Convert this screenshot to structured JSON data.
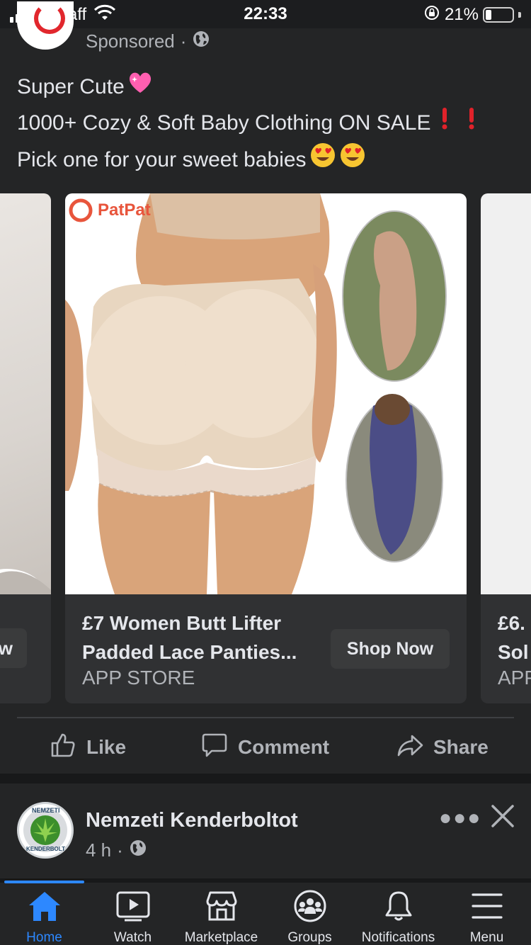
{
  "status_bar": {
    "carrier": "giffgaff",
    "time": "22:33",
    "battery_percent": "21%",
    "battery_level": 0.21,
    "signal_bars": 2
  },
  "post": {
    "sponsored_label": "Sponsored",
    "separator": "·",
    "text_lines": [
      "Super Cute",
      "1000+ Cozy & Soft Baby Clothing ON SALE",
      "Pick one for your sweet babies"
    ],
    "carousel": {
      "left_card": {
        "button_label_fragment": "ow"
      },
      "main_card": {
        "brand_logo": "PatPat",
        "title_line1": "£7 Women Butt Lifter",
        "title_line2": "Padded Lace Panties...",
        "source": "APP STORE",
        "cta_label": "Shop Now"
      },
      "right_card": {
        "title_line1": "£6.",
        "title_line2": "Sol",
        "source": "APP"
      }
    },
    "actions": {
      "like": "Like",
      "comment": "Comment",
      "share": "Share"
    }
  },
  "next_post": {
    "page_name": "Nemzeti Kenderboltot",
    "time": "4 h",
    "separator": "·",
    "avatar_text_top": "NEMZETI",
    "avatar_text_bottom": "KENDERBOLT"
  },
  "tab_bar": {
    "tabs": [
      {
        "label": "Home",
        "icon": "home-icon",
        "active": true
      },
      {
        "label": "Watch",
        "icon": "watch-icon",
        "active": false
      },
      {
        "label": "Marketplace",
        "icon": "marketplace-icon",
        "active": false
      },
      {
        "label": "Groups",
        "icon": "groups-icon",
        "active": false
      },
      {
        "label": "Notifications",
        "icon": "bell-icon",
        "active": false
      },
      {
        "label": "Menu",
        "icon": "menu-icon",
        "active": false
      }
    ]
  },
  "colors": {
    "background": "#242526",
    "accent": "#2d88ff",
    "text": "#e4e6eb",
    "secondary_text": "#b0b3b8",
    "heart": "#ff4fa3",
    "exclamation": "#e0222a"
  }
}
